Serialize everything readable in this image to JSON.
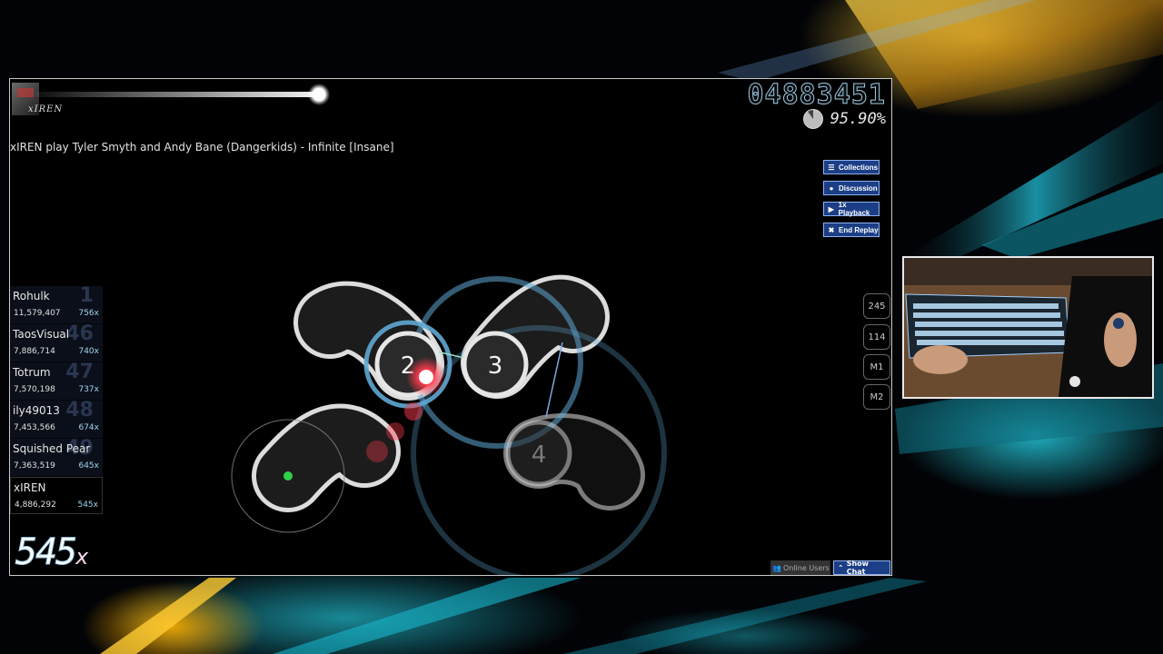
{
  "window": {
    "player_tag": "xIREN",
    "score": "04883451",
    "accuracy": "95.90%",
    "song_title": "xIREN play Tyler Smyth and Andy Bane (Dangerkids) - Infinite [Insane]",
    "combo": "545",
    "combo_x": "x"
  },
  "menu_buttons": [
    {
      "label": "Collections",
      "icon": "list-icon",
      "glyph": "☰"
    },
    {
      "label": "Discussion",
      "icon": "chat-bubble-icon",
      "glyph": "●"
    },
    {
      "label": "1x Playback",
      "icon": "play-icon",
      "glyph": "▶"
    },
    {
      "label": "End Replay",
      "icon": "close-icon",
      "glyph": "✖"
    }
  ],
  "leaderboard": [
    {
      "name": "Rohulk",
      "score": "11,579,407",
      "combo": "756x",
      "rank": "1"
    },
    {
      "name": "TaosVisual",
      "score": "7,886,714",
      "combo": "740x",
      "rank": "46"
    },
    {
      "name": "Totrum",
      "score": "7,570,198",
      "combo": "737x",
      "rank": "47"
    },
    {
      "name": "ily49013",
      "score": "7,453,566",
      "combo": "674x",
      "rank": "48"
    },
    {
      "name": "Squished Pear",
      "score": "7,363,519",
      "combo": "645x",
      "rank": "49"
    },
    {
      "name": "xIREN",
      "score": "4,886,292",
      "combo": "545x",
      "rank": ""
    }
  ],
  "key_overlay": [
    "245",
    "114",
    "M1",
    "M2"
  ],
  "hit_circles": [
    "2",
    "3",
    "4"
  ],
  "bottom_bar": {
    "online_users": "Online Users",
    "show_chat": "Show Chat"
  },
  "colors": {
    "button_blue": "#1b3e86",
    "button_border": "#8fb0f0",
    "approach_blue": "#5fa8d3",
    "cursor_red": "#ff3b4d"
  }
}
